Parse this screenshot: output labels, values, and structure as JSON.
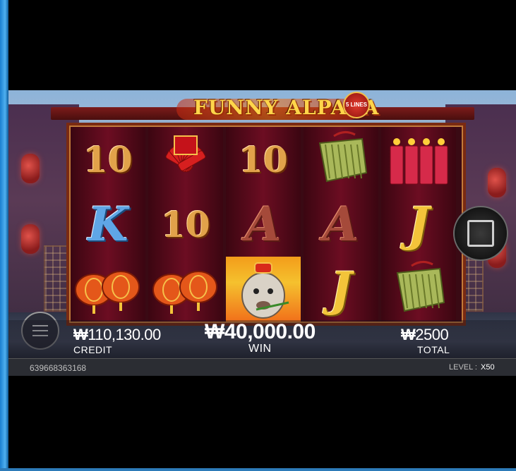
{
  "game": {
    "title": "FUNNY ALPACA",
    "lines_badge": "5 LINES"
  },
  "reels": [
    [
      {
        "kind": "num",
        "text": "10"
      },
      {
        "kind": "letter",
        "text": "K",
        "style": "k"
      },
      {
        "kind": "pic",
        "name": "lucky-lanterns"
      }
    ],
    [
      {
        "kind": "pic",
        "name": "firecracker-bundle"
      },
      {
        "kind": "num",
        "text": "10"
      },
      {
        "kind": "pic",
        "name": "lucky-lanterns"
      }
    ],
    [
      {
        "kind": "num",
        "text": "10"
      },
      {
        "kind": "letter",
        "text": "A",
        "style": "a"
      },
      {
        "kind": "pic",
        "name": "alpaca-wild"
      }
    ],
    [
      {
        "kind": "pic",
        "name": "jade-ingots"
      },
      {
        "kind": "letter",
        "text": "A",
        "style": "a"
      },
      {
        "kind": "letter",
        "text": "J",
        "style": "j"
      }
    ],
    [
      {
        "kind": "pic",
        "name": "firecracker-sticks"
      },
      {
        "kind": "letter",
        "text": "J",
        "style": "j"
      },
      {
        "kind": "pic",
        "name": "jade-ingots"
      }
    ]
  ],
  "stats": {
    "credit_currency": "₩",
    "credit_value": "110,130.00",
    "credit_label": "CREDIT",
    "win_currency": "₩",
    "win_value": "40,000.00",
    "win_label": "WIN",
    "total_currency": "₩",
    "total_value": "2500",
    "total_label": "TOTAL"
  },
  "footer": {
    "round_id": "639668363168",
    "level_label": "LEVEL :",
    "level_value": "X50"
  },
  "icons": {
    "stop": "stop-square-icon",
    "menu": "hamburger-menu-icon"
  },
  "colors": {
    "gold": "#ffd54a",
    "reel_bg": "#6c0d22",
    "frame": "#7a2a12"
  }
}
